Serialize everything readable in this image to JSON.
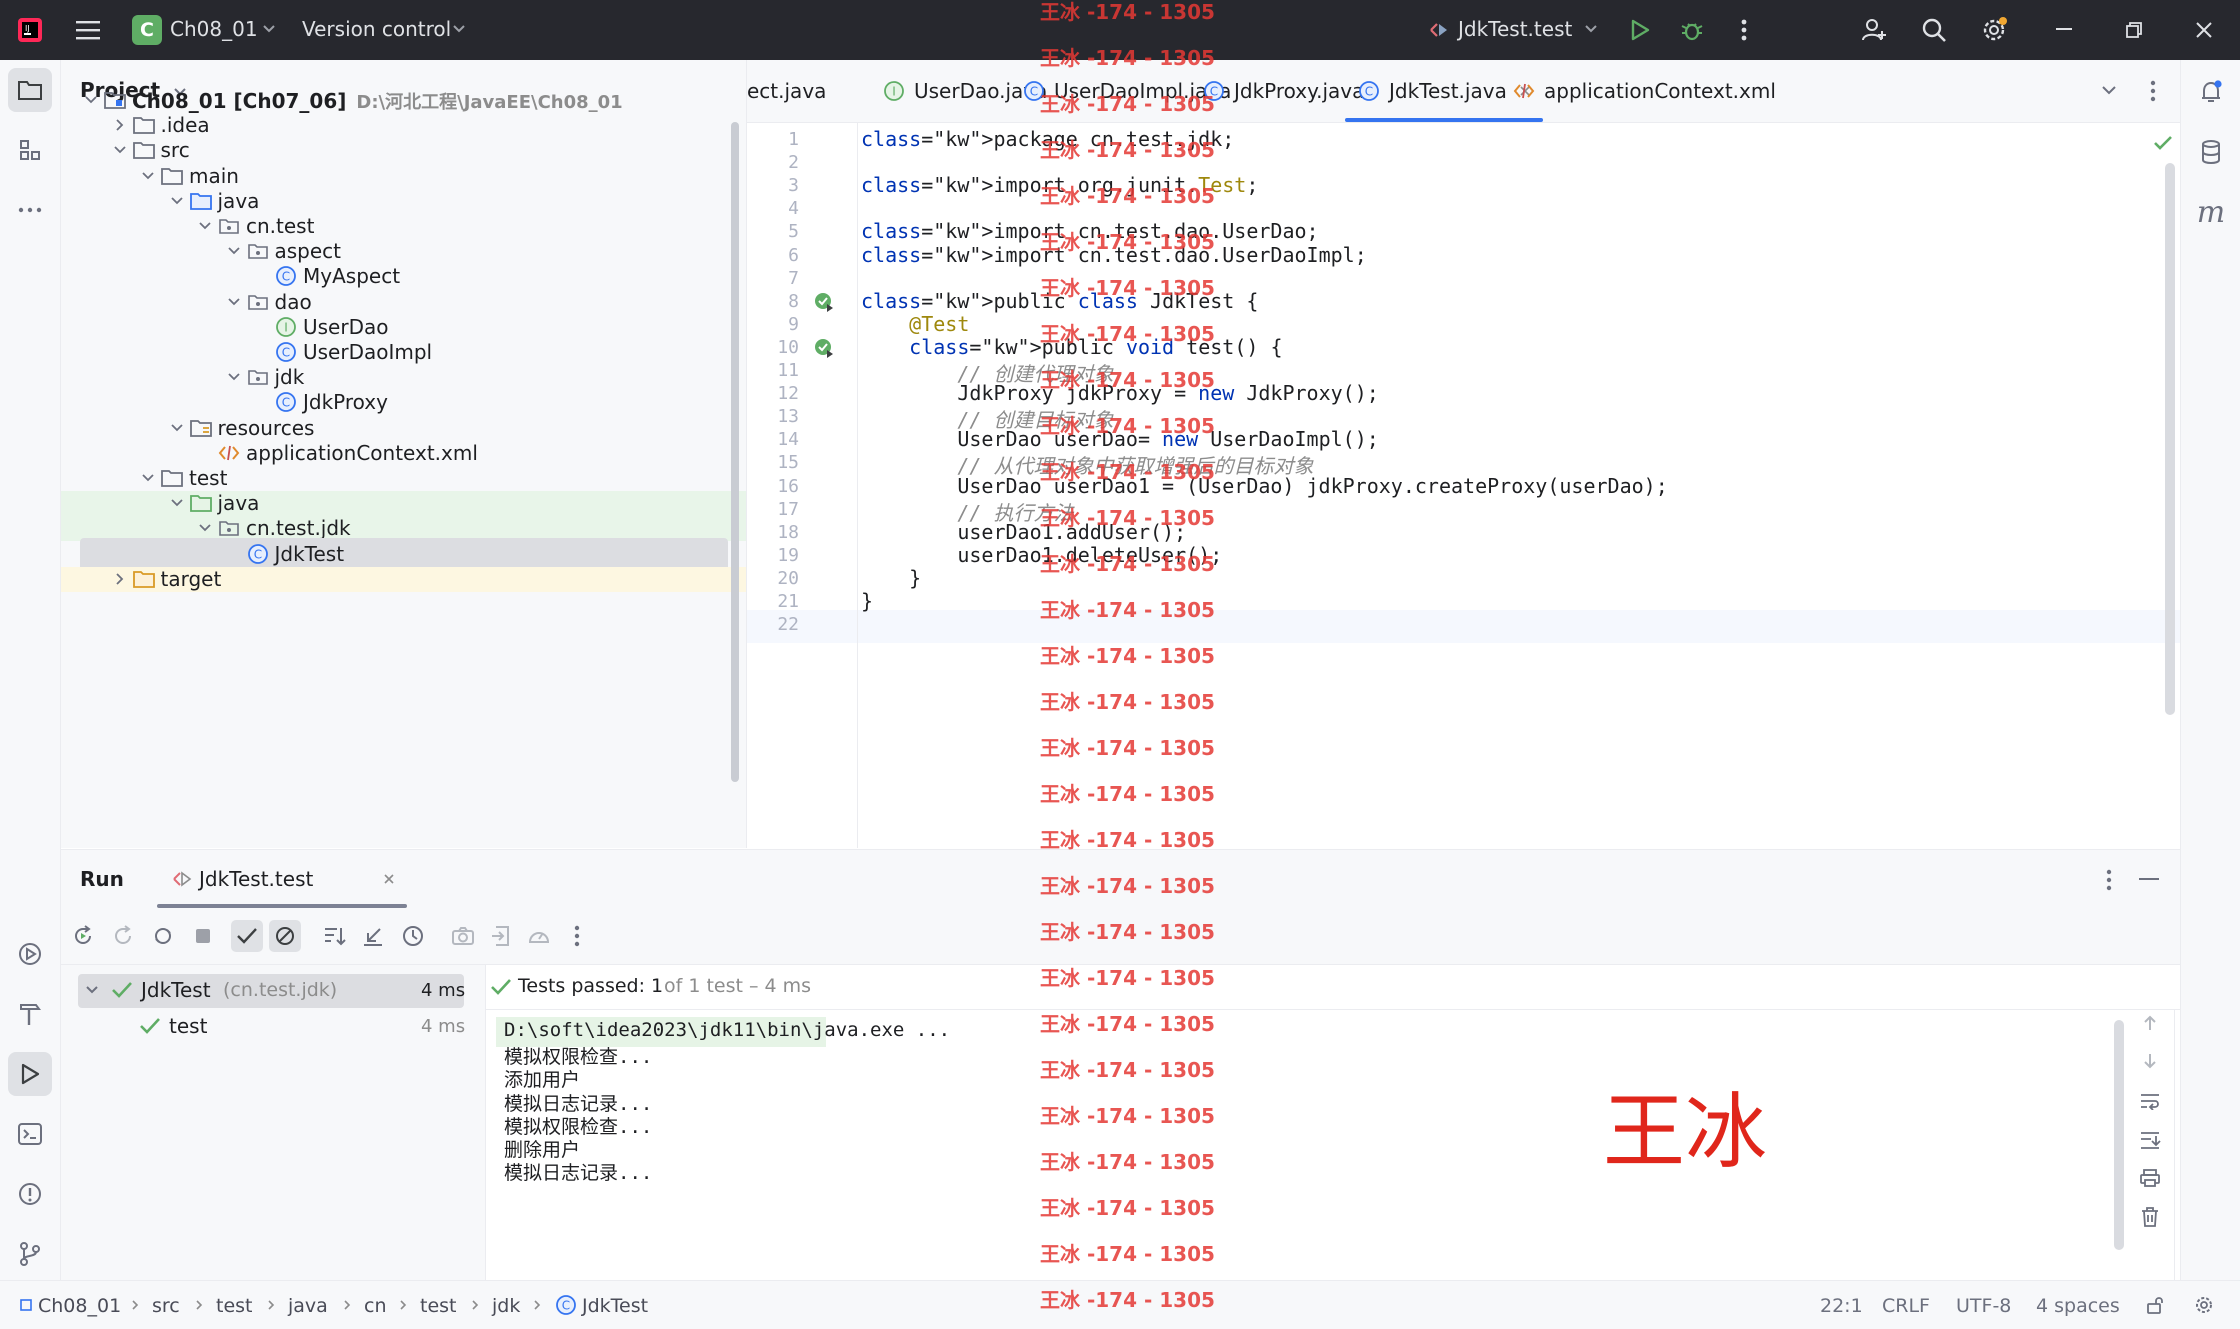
{
  "titlebar": {
    "project_letter": "C",
    "project_name": "Ch08_01",
    "vcs": "Version control",
    "run_config": "JdkTest.test"
  },
  "project_panel": {
    "title": "Project",
    "tree": [
      {
        "label": "Ch08_01 [Ch07_06]",
        "path": "D:\\河北工程\\JavaEE\\Ch08_01",
        "depth": 0,
        "expanded": true,
        "icon": "module-folder-icon"
      },
      {
        "label": ".idea",
        "depth": 1,
        "expanded": false,
        "icon": "folder-icon"
      },
      {
        "label": "src",
        "depth": 1,
        "expanded": true,
        "icon": "folder-icon"
      },
      {
        "label": "main",
        "depth": 2,
        "expanded": true,
        "icon": "folder-icon"
      },
      {
        "label": "java",
        "depth": 3,
        "expanded": true,
        "icon": "source-folder-icon"
      },
      {
        "label": "cn.test",
        "depth": 4,
        "expanded": true,
        "icon": "package-icon"
      },
      {
        "label": "aspect",
        "depth": 5,
        "expanded": true,
        "icon": "package-icon"
      },
      {
        "label": "MyAspect",
        "depth": 6,
        "icon": "class-icon"
      },
      {
        "label": "dao",
        "depth": 5,
        "expanded": true,
        "icon": "package-icon"
      },
      {
        "label": "UserDao",
        "depth": 6,
        "icon": "interface-icon"
      },
      {
        "label": "UserDaoImpl",
        "depth": 6,
        "icon": "class-icon"
      },
      {
        "label": "jdk",
        "depth": 5,
        "expanded": true,
        "icon": "package-icon"
      },
      {
        "label": "JdkProxy",
        "depth": 6,
        "icon": "class-icon"
      },
      {
        "label": "resources",
        "depth": 3,
        "expanded": true,
        "icon": "resources-folder-icon"
      },
      {
        "label": "applicationContext.xml",
        "depth": 4,
        "icon": "xml-file-icon"
      },
      {
        "label": "test",
        "depth": 2,
        "expanded": true,
        "icon": "folder-icon"
      },
      {
        "label": "java",
        "depth": 3,
        "expanded": true,
        "icon": "test-folder-icon"
      },
      {
        "label": "cn.test.jdk",
        "depth": 4,
        "expanded": true,
        "icon": "package-icon"
      },
      {
        "label": "JdkTest",
        "depth": 5,
        "icon": "class-icon"
      },
      {
        "label": "target",
        "depth": 1,
        "expanded": false,
        "icon": "excluded-folder-icon"
      }
    ]
  },
  "tabs": [
    {
      "label": "ect.java",
      "icon": "none"
    },
    {
      "label": "UserDao.java",
      "icon": "interface-icon"
    },
    {
      "label": "UserDaoImpl.java",
      "icon": "class-icon"
    },
    {
      "label": "JdkProxy.java",
      "icon": "class-icon"
    },
    {
      "label": "JdkTest.java",
      "icon": "class-icon",
      "active": true
    },
    {
      "label": "applicationContext.xml",
      "icon": "xml-file-icon"
    }
  ],
  "editor": {
    "lines": [
      {
        "n": "1",
        "code": "package cn.test.jdk;"
      },
      {
        "n": "2",
        "code": ""
      },
      {
        "n": "3",
        "code": "import org.junit.Test;"
      },
      {
        "n": "4",
        "code": ""
      },
      {
        "n": "5",
        "code": "import cn.test.dao.UserDao;"
      },
      {
        "n": "6",
        "code": "import cn.test.dao.UserDaoImpl;"
      },
      {
        "n": "7",
        "code": ""
      },
      {
        "n": "8",
        "code": "public class JdkTest {"
      },
      {
        "n": "9",
        "code": "    @Test"
      },
      {
        "n": "10",
        "code": "    public void test() {"
      },
      {
        "n": "11",
        "code": "        // 创建代理对象"
      },
      {
        "n": "12",
        "code": "        JdkProxy jdkProxy = new JdkProxy();"
      },
      {
        "n": "13",
        "code": "        // 创建目标对象"
      },
      {
        "n": "14",
        "code": "        UserDao userDao= new UserDaoImpl();"
      },
      {
        "n": "15",
        "code": "        // 从代理对象中获取增强后的目标对象"
      },
      {
        "n": "16",
        "code": "        UserDao userDao1 = (UserDao) jdkProxy.createProxy(userDao);"
      },
      {
        "n": "17",
        "code": "        // 执行方法"
      },
      {
        "n": "18",
        "code": "        userDao1.addUser();"
      },
      {
        "n": "19",
        "code": "        userDao1.deleteUser();"
      },
      {
        "n": "20",
        "code": "    }"
      },
      {
        "n": "21",
        "code": "}"
      },
      {
        "n": "22",
        "code": ""
      }
    ]
  },
  "run": {
    "title": "Run",
    "tab_label": "JdkTest.test",
    "tests": [
      {
        "name": "JdkTest",
        "qualifier": "(cn.test.jdk)",
        "time": "4 ms"
      },
      {
        "name": "test",
        "qualifier": "",
        "time": "4 ms"
      }
    ],
    "summary_bold": "Tests passed: 1",
    "summary_rest": "of 1 test – 4 ms",
    "console": [
      "D:\\soft\\idea2023\\jdk11\\bin\\java.exe ...",
      "模拟权限检查...",
      "添加用户",
      "模拟日志记录...",
      "模拟权限检查...",
      "删除用户",
      "模拟日志记录..."
    ]
  },
  "statusbar": {
    "breadcrumbs": [
      "Ch08_01",
      "src",
      "test",
      "java",
      "cn",
      "test",
      "jdk",
      "JdkTest"
    ],
    "position": "22:1",
    "line_sep": "CRLF",
    "encoding": "UTF-8",
    "indent": "4 spaces"
  },
  "watermark": {
    "text": "王冰 -174 - 1305",
    "name": "王冰"
  },
  "colors": {
    "accent": "#3574f0",
    "success": "#5fad65",
    "watermark": "#e53935"
  }
}
